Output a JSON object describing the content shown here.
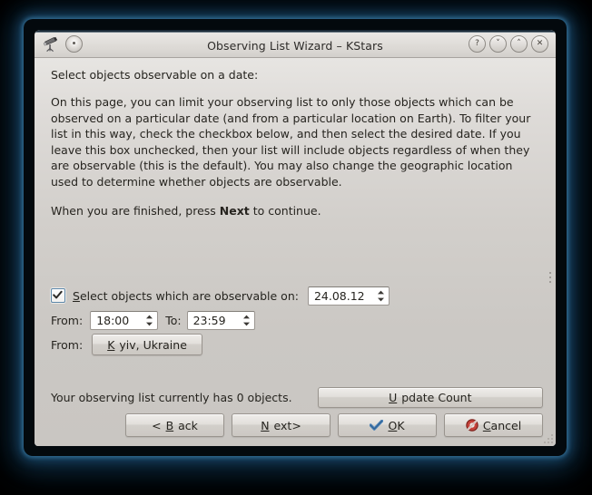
{
  "window": {
    "title": "Observing List Wizard – KStars",
    "app_icon": "telescope-icon",
    "controls": {
      "help": "?",
      "shade": "˅",
      "maximize": "˄",
      "close": "✕"
    }
  },
  "page": {
    "heading": "Select objects observable on a date:",
    "paragraph_1": "On this page, you can limit your observing list to only those objects which can be observed on a particular date (and from a particular location on Earth). To filter your list in this way, check the checkbox below, and then select the desired date. If you leave this box unchecked, then your list will include objects regardless of when they are observable (this is the default). You may also change the geographic location used to determine whether objects are observable.",
    "paragraph_2_prefix": "When you are finished, press ",
    "paragraph_2_bold": "Next",
    "paragraph_2_suffix": " to continue."
  },
  "form": {
    "observable_checkbox": {
      "checked": true,
      "label_accel": "S",
      "label_rest": "elect objects which are observable on:"
    },
    "date_value": "24.08.12",
    "from_time_label": "From:",
    "from_time_value": "18:00",
    "to_time_label": "To:",
    "to_time_value": "23:59",
    "from_location_label": "From:",
    "location_accel": "K",
    "location_rest": "yiv, Ukraine"
  },
  "footer": {
    "status_text": "Your observing list currently has 0 objects.",
    "update_count_accel": "U",
    "update_count_rest": "pdate Count",
    "back_prefix": "< ",
    "back_accel": "B",
    "back_rest": "ack",
    "next_accel": "N",
    "next_rest": "ext>",
    "ok_accel": "O",
    "ok_rest": "K",
    "cancel_accel": "C",
    "cancel_rest": "ancel"
  },
  "colors": {
    "accent_glow": "#2b6e9e",
    "window_bg": "#cbc8c4",
    "titlebar_top": "#1b2b38",
    "text": "#26241f",
    "checkbox_border": "#5d87a8",
    "ok_check": "#3a6ea5",
    "cancel_red": "#b4342a"
  }
}
